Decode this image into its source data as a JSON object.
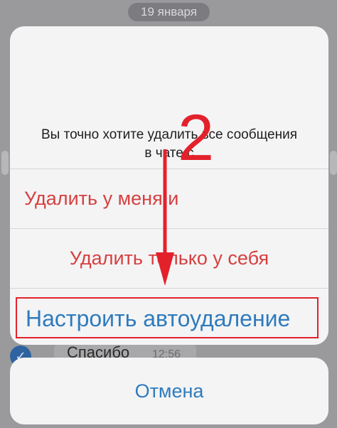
{
  "background": {
    "date_label": "19 января",
    "message_text": "Спасибо",
    "message_time": "12:56"
  },
  "dialog": {
    "message_line1": "Вы точно хотите удалить все сообщения",
    "message_line2": "в чате с",
    "delete_for_me_and": "Удалить у меня и",
    "delete_only_for_me": "Удалить только у себя",
    "configure_autodelete": "Настроить автоудаление",
    "cancel": "Отмена"
  },
  "annotation": {
    "step_number": "2",
    "color": "#e3212b"
  },
  "colors": {
    "destructive": "#d5403f",
    "action_blue": "#2f7bbd",
    "highlight_border": "#e4222b"
  },
  "icons": {
    "selected_check": "checkmark-icon"
  }
}
